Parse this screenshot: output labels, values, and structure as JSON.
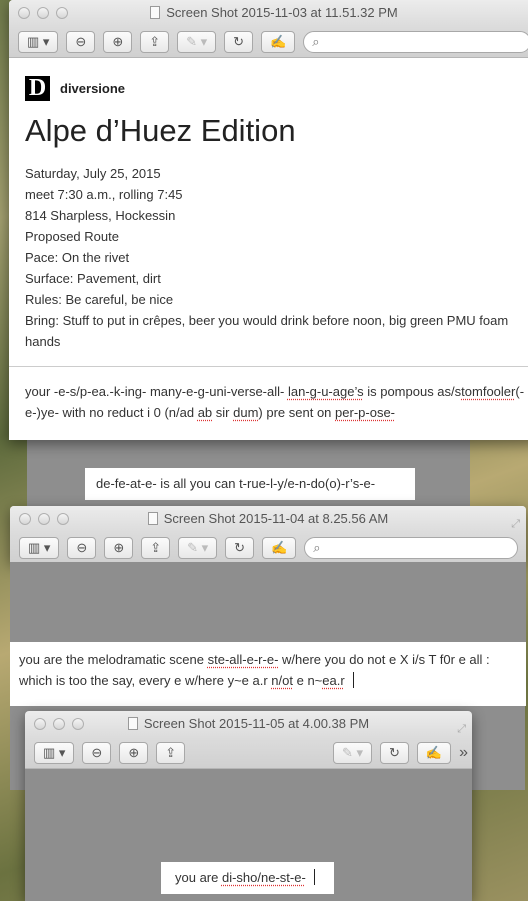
{
  "window1": {
    "title": "Screen Shot 2015-11-03 at 11.51.32 PM",
    "logo_letter": "D",
    "brand": "diversione",
    "headline": "Alpe d’Huez Edition",
    "details": [
      "Saturday, July 25, 2015",
      "meet 7:30 a.m., rolling 7:45",
      "814 Sharpless, Hockessin",
      "Proposed Route",
      "Pace: On the rivet",
      "Surface: Pavement, dirt",
      "Rules: Be careful, be nice",
      "Bring: Stuff to put in crêpes, beer you would drink before noon, big green PMU foam hands"
    ],
    "poem": [
      "your -e-s/p-ea.-k-ing- many-e-g-uni-verse-all- ",
      "lan-g-u-age’s",
      " is pompous as/s",
      "tomfooler",
      "(-e-)ye- with no reduct i 0 (n/ad ",
      "ab",
      " sir ",
      "dum",
      ") pre sent on ",
      "per-p-ose-"
    ]
  },
  "floating_note": "de-fe-at-e- is all you can t-rue-l-y/e-n-do(o)-r’s-e-",
  "window2": {
    "title": "Screen Shot 2015-11-04 at 8.25.56 AM",
    "text": [
      "you are the melodramatic scene ",
      "ste-all-e-r-e-",
      " w/here you do not e X i/s T f0r e all : which is too the say, every e w/here y~e a.r ",
      "n/ot",
      " e n~",
      "ea.r"
    ]
  },
  "window3": {
    "title": "Screen Shot 2015-11-05 at 4.00.38 PM",
    "text": [
      "you are ",
      "di-sho/ne-st-e-"
    ],
    "overflow": "»"
  },
  "toolbar": {
    "sidebar": "▥ ▾",
    "zoom_out": "⊖",
    "zoom_in": "⊕",
    "share": "⇪",
    "annotate": "✎ ▾",
    "rotate": "↻",
    "edit": "✍",
    "search_icon": "⌕"
  }
}
